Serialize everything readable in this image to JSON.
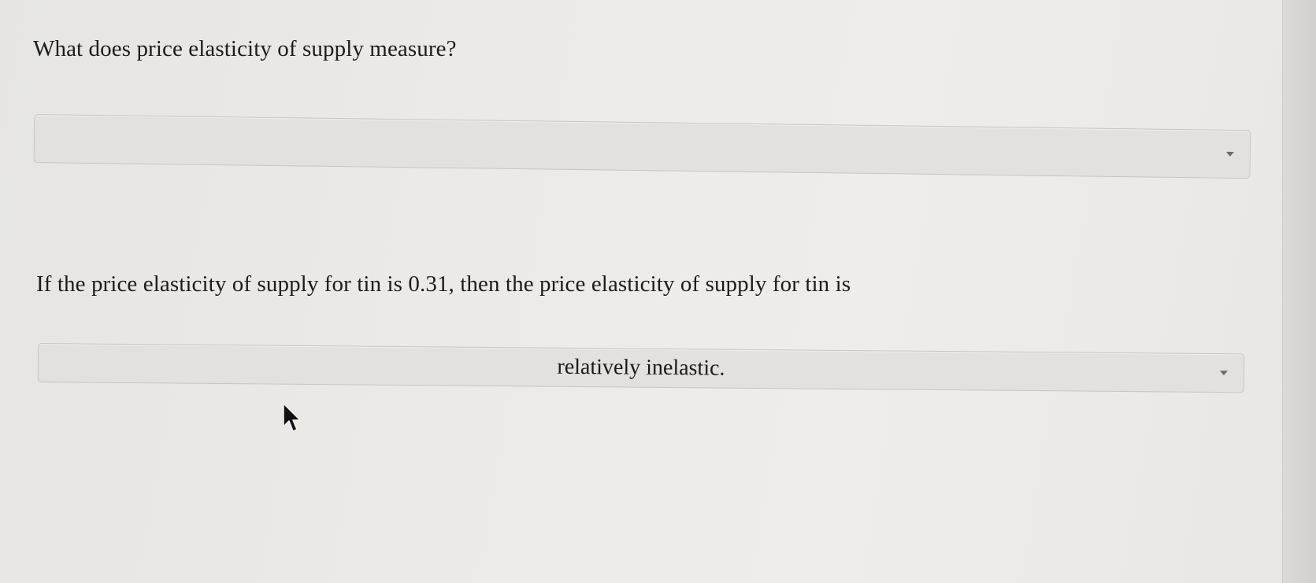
{
  "questions": [
    {
      "text": "What does price elasticity of supply measure?",
      "dropdown": {
        "selected": "",
        "icon": "chevron-down-icon"
      }
    },
    {
      "text": "If the price elasticity of supply for tin is 0.31, then the price elasticity of supply for tin is",
      "dropdown": {
        "selected": "relatively inelastic.",
        "icon": "chevron-down-icon"
      }
    }
  ],
  "cursor": {
    "icon": "mouse-pointer-icon"
  }
}
